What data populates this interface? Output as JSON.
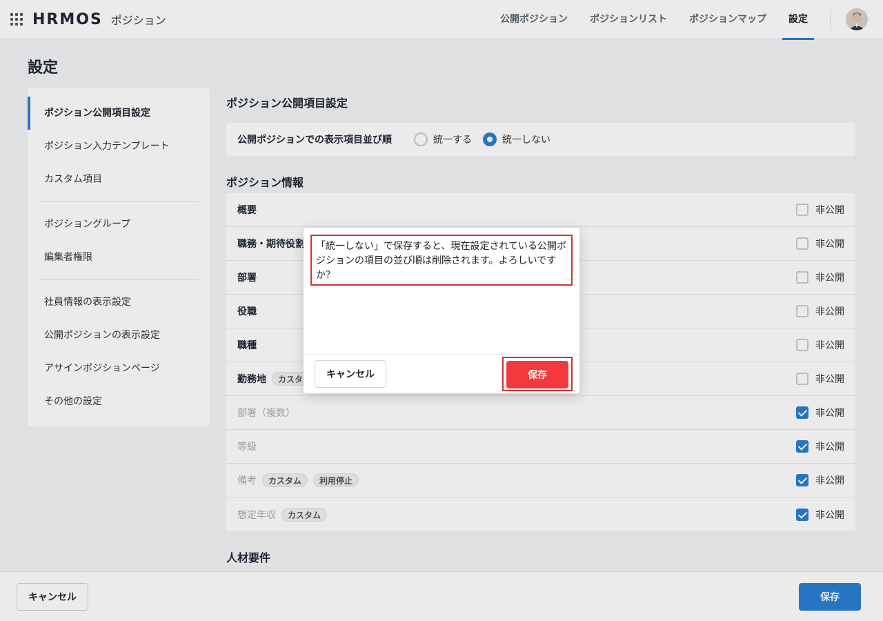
{
  "header": {
    "logo": "HRMOS",
    "product": "ポジション",
    "nav": [
      {
        "label": "公開ポジション"
      },
      {
        "label": "ポジションリスト"
      },
      {
        "label": "ポジションマップ"
      },
      {
        "label": "設定"
      }
    ],
    "active_nav": "設定"
  },
  "page_title": "設定",
  "sidebar": {
    "groups": [
      [
        "ポジション公開項目設定",
        "ポジション入力テンプレート",
        "カスタム項目"
      ],
      [
        "ポジショングループ",
        "編集者権限"
      ],
      [
        "社員情報の表示設定",
        "公開ポジションの表示設定",
        "アサインポジションページ",
        "その他の設定"
      ]
    ],
    "active": "ポジション公開項目設定"
  },
  "main": {
    "section_title": "ポジション公開項目設定",
    "order": {
      "label": "公開ポジションでの表示項目並び順",
      "options": [
        "統一する",
        "統一しない"
      ],
      "selected": "統一しない"
    },
    "info_title": "ポジション情報",
    "rows": [
      {
        "name": "概要",
        "tags": [],
        "checked": false,
        "disabled": false
      },
      {
        "name": "職務・期待役割",
        "tags": [],
        "checked": false,
        "disabled": false
      },
      {
        "name": "部署",
        "tags": [],
        "checked": false,
        "disabled": false
      },
      {
        "name": "役職",
        "tags": [],
        "checked": false,
        "disabled": false
      },
      {
        "name": "職種",
        "tags": [],
        "checked": false,
        "disabled": false
      },
      {
        "name": "勤務地",
        "tags": [
          "カスタム"
        ],
        "checked": false,
        "disabled": false
      },
      {
        "name": "部署（複数）",
        "tags": [],
        "checked": true,
        "disabled": true
      },
      {
        "name": "等級",
        "tags": [],
        "checked": true,
        "disabled": true
      },
      {
        "name": "備考",
        "tags": [
          "カスタム",
          "利用停止"
        ],
        "checked": true,
        "disabled": true
      },
      {
        "name": "想定年収",
        "tags": [
          "カスタム"
        ],
        "checked": true,
        "disabled": true
      }
    ],
    "private_label": "非公開",
    "next_title": "人材要件"
  },
  "footer": {
    "cancel": "キャンセル",
    "save": "保存"
  },
  "dialog": {
    "message": "「統一しない」で保存すると、現在設定されている公開ポジションの項目の並び順は削除されます。よろしいですか？",
    "cancel": "キャンセル",
    "save": "保存"
  },
  "colors": {
    "accent": "#2b7fd3",
    "danger": "#f2393d",
    "highlight": "#d0312d"
  }
}
